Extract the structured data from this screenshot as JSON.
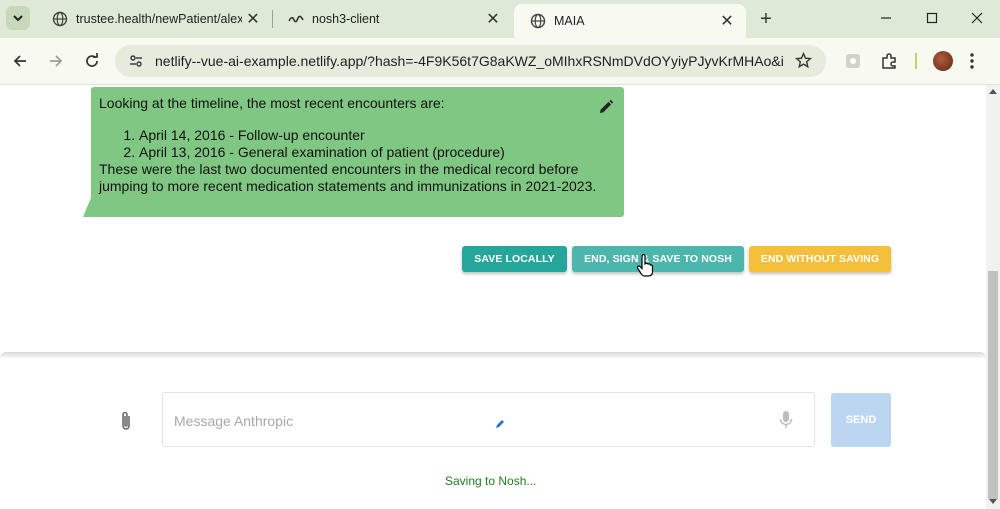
{
  "browser": {
    "tabs": [
      {
        "title": "trustee.health/newPatient/alex@",
        "active": false
      },
      {
        "title": "nosh3-client",
        "active": false
      },
      {
        "title": "MAIA",
        "active": true
      }
    ],
    "url": "netlify--vue-ai-example.netlify.app/?hash=-4F9K56t7G8aKWZ_oMIhxRSNmDVdOYyiyPJyvKrMHAo&i..."
  },
  "message": {
    "intro": "Looking at the timeline, the most recent encounters are:",
    "items": [
      "April 14, 2016 - Follow-up encounter",
      "April 13, 2016 - General examination of patient (procedure)"
    ],
    "outro": "These were the last two documented encounters in the medical record before jumping to more recent medication statements and immunizations in 2021-2023."
  },
  "actions": {
    "save_locally": "SAVE LOCALLY",
    "end_sign_save": "END, SIGN & SAVE TO NOSH",
    "end_without_saving": "END WITHOUT SAVING"
  },
  "composer": {
    "placeholder": "Message Anthropic",
    "send_label": "SEND"
  },
  "status": "Saving to Nosh...",
  "colors": {
    "bubble": "#80c783",
    "save_locally": "#26a69a",
    "end_sign_save": "#4db6ac",
    "end_without_saving": "#f4c03c",
    "send_disabled": "#bcd6f2",
    "status_text": "#1f7a1f"
  }
}
